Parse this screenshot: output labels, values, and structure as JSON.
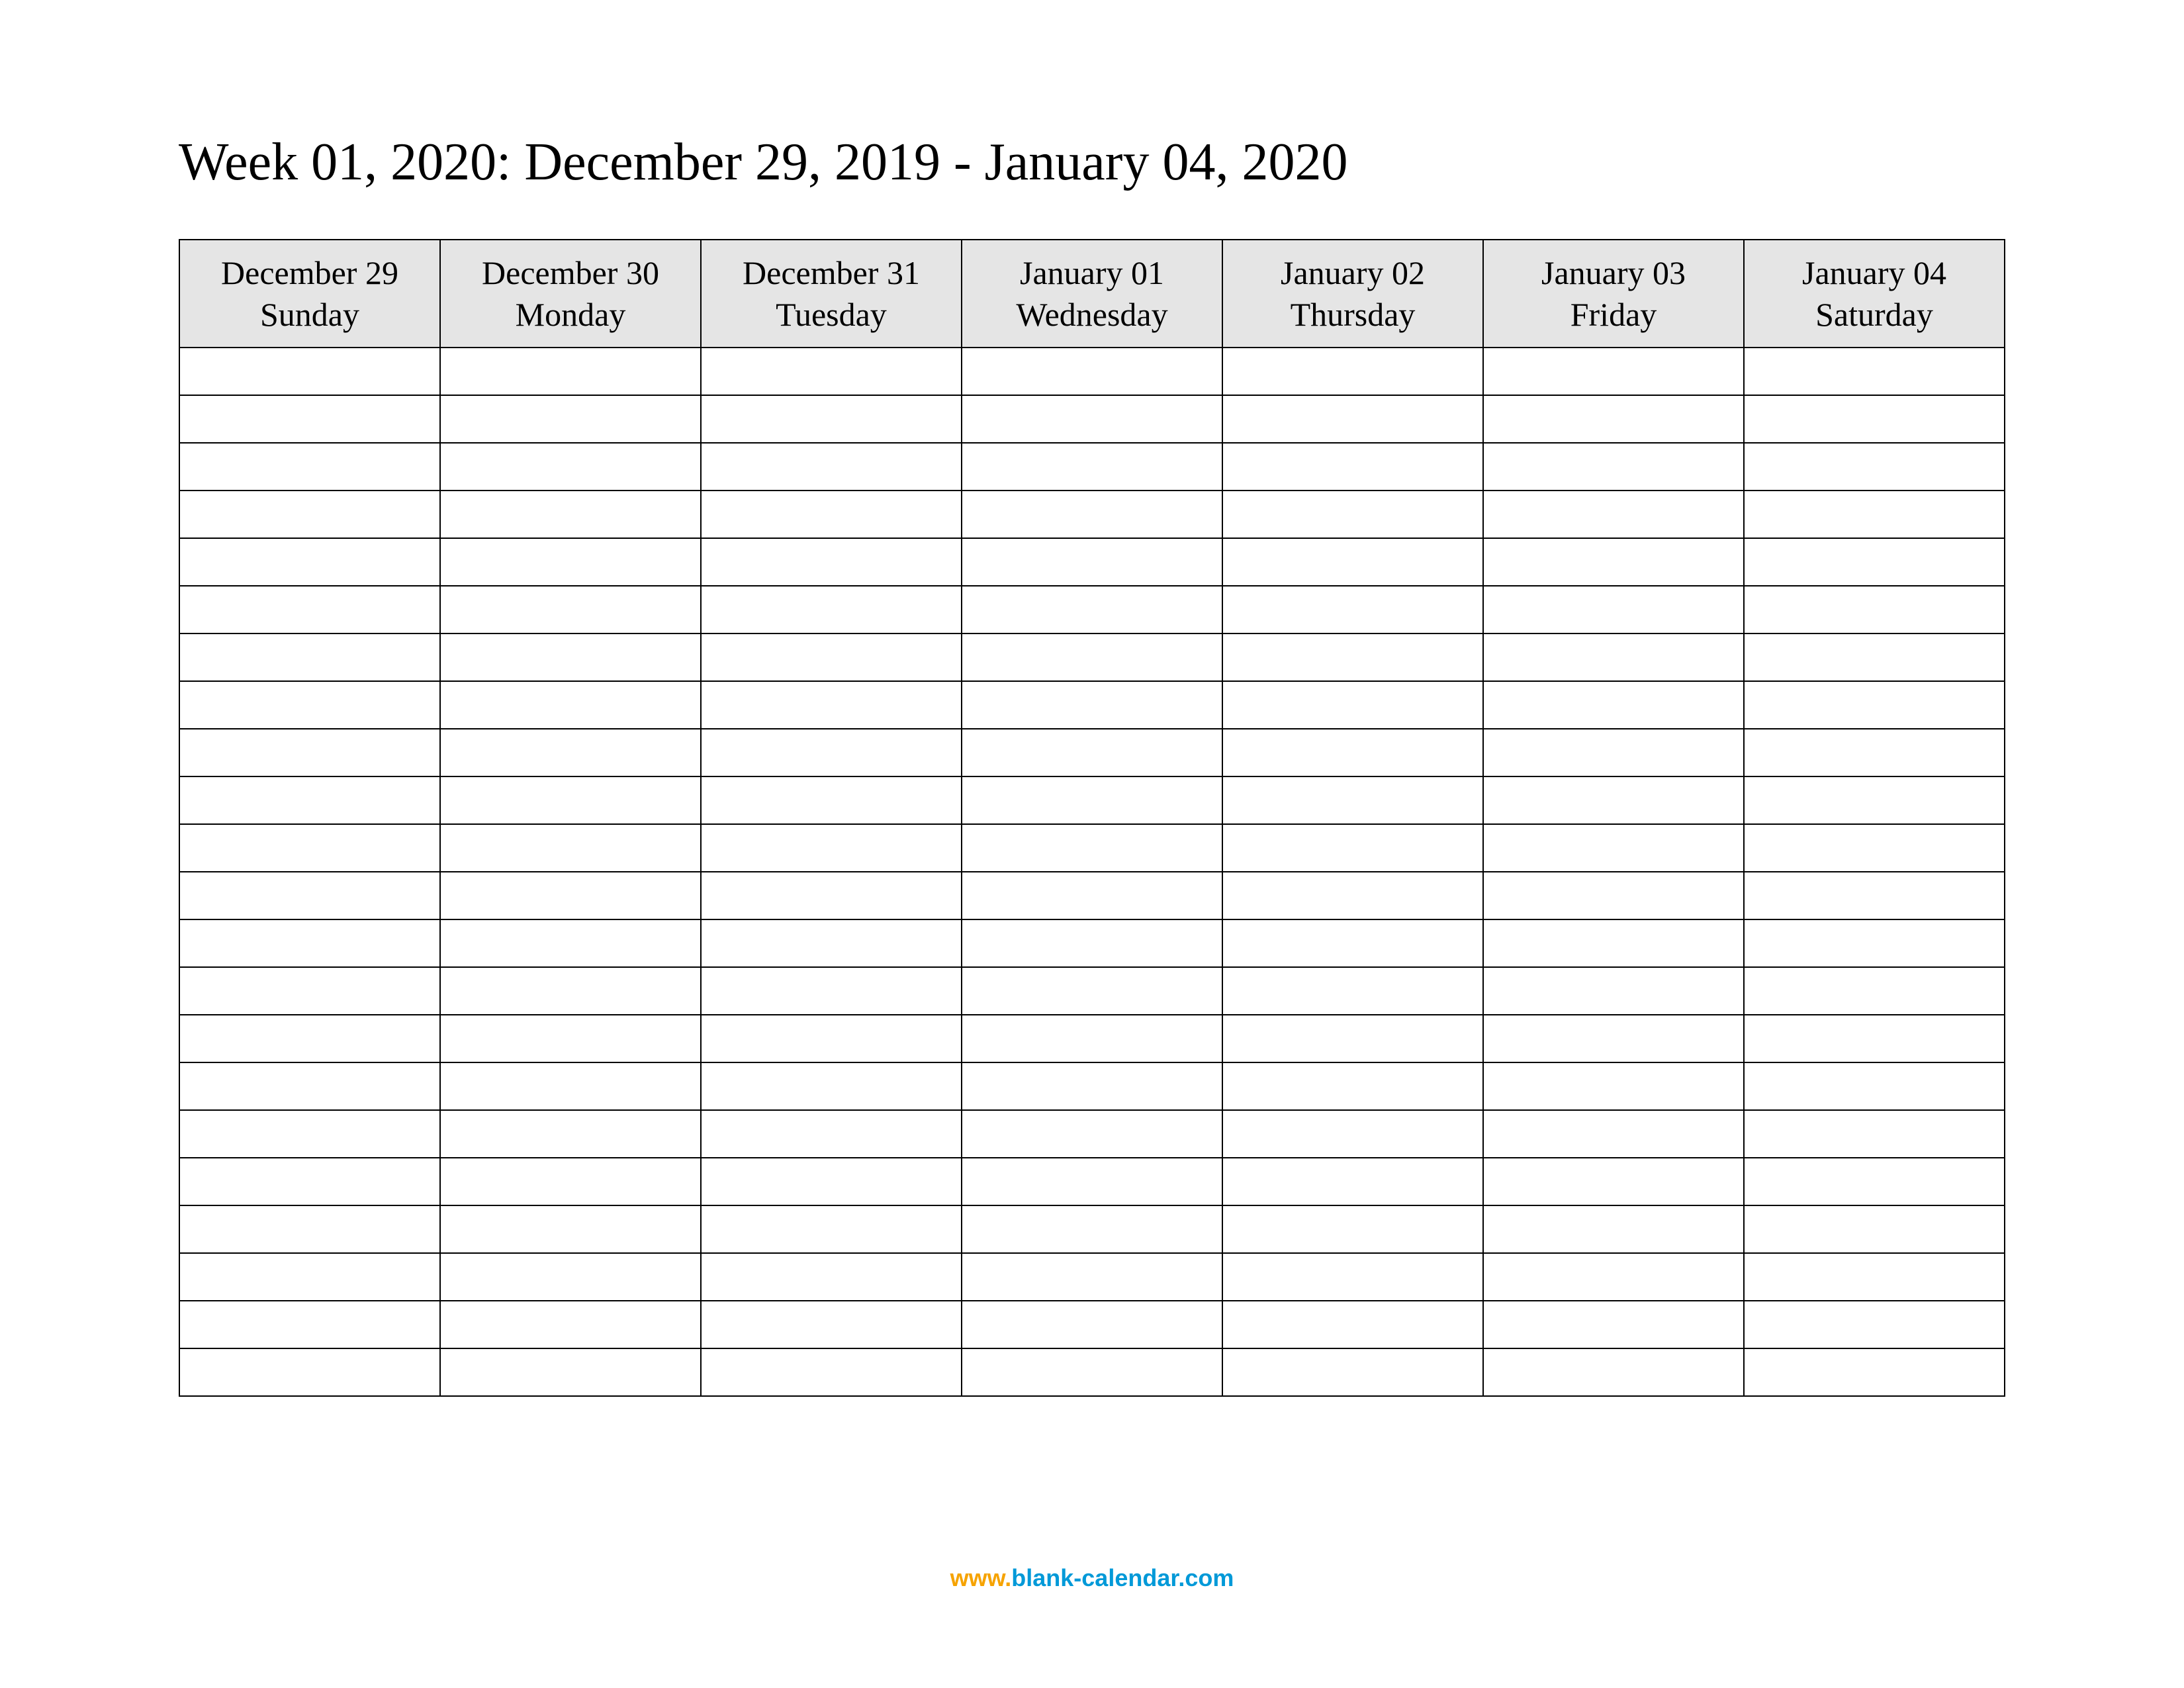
{
  "title": "Week 01, 2020: December 29, 2019 - January 04, 2020",
  "columns": [
    {
      "date": "December 29",
      "weekday": "Sunday"
    },
    {
      "date": "December 30",
      "weekday": "Monday"
    },
    {
      "date": "December 31",
      "weekday": "Tuesday"
    },
    {
      "date": "January 01",
      "weekday": "Wednesday"
    },
    {
      "date": "January 02",
      "weekday": "Thursday"
    },
    {
      "date": "January 03",
      "weekday": "Friday"
    },
    {
      "date": "January 04",
      "weekday": "Saturday"
    }
  ],
  "row_count": 22,
  "footer": {
    "www": "www.",
    "domain": "blank-calendar.com"
  }
}
